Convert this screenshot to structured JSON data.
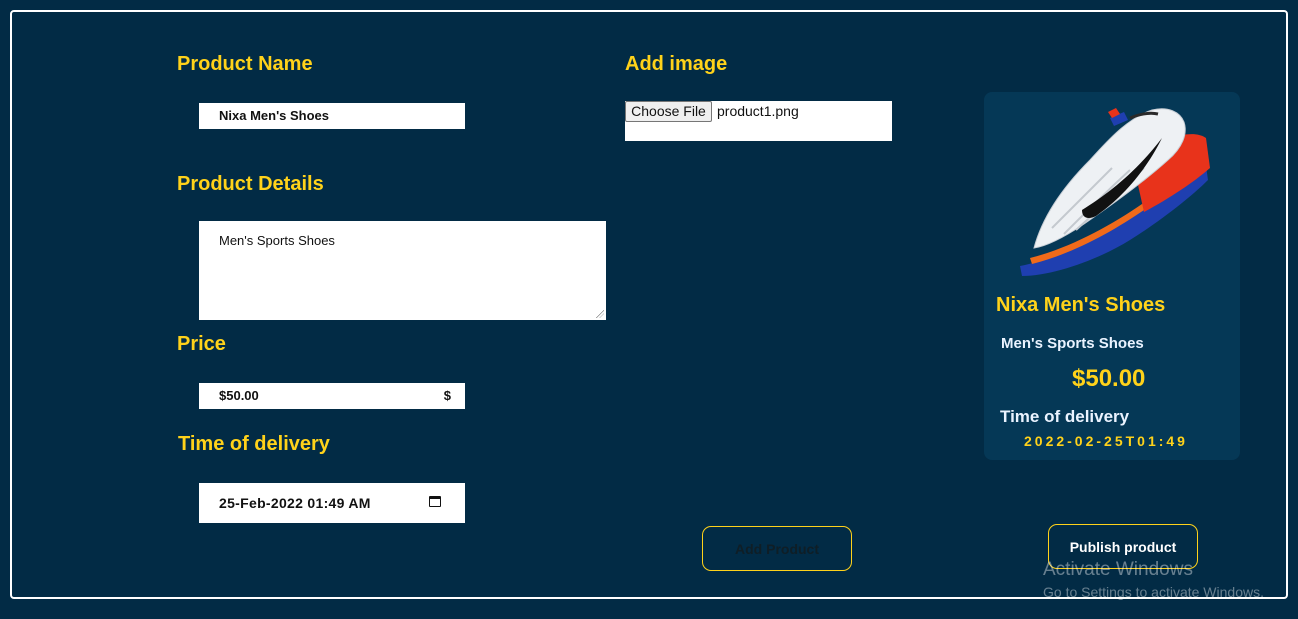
{
  "form": {
    "product_name_label": "Product Name",
    "product_name_value": "Nixa Men's Shoes",
    "product_details_label": "Product Details",
    "product_details_value": "Men's Sports Shoes",
    "price_label": "Price",
    "price_value": "$50.00",
    "price_suffix": "$",
    "delivery_label": "Time of delivery",
    "delivery_value": "25-Feb-2022 01:49 AM",
    "add_image_label": "Add image",
    "choose_file_label": "Choose File",
    "file_name": "product1.png"
  },
  "preview": {
    "image_name": "sneaker-image",
    "title": "Nixa Men's Shoes",
    "description": "Men's Sports Shoes",
    "price": "$50.00",
    "delivery_label": "Time of delivery",
    "delivery_value": "2022-02-25T01:49"
  },
  "buttons": {
    "add_product": "Add Product",
    "publish_product": "Publish product"
  },
  "watermark": {
    "line1": "Activate Windows",
    "line2": "Go to Settings to activate Windows."
  },
  "colors": {
    "background": "#022b45",
    "accent": "#ffd21a",
    "card": "#053856"
  }
}
